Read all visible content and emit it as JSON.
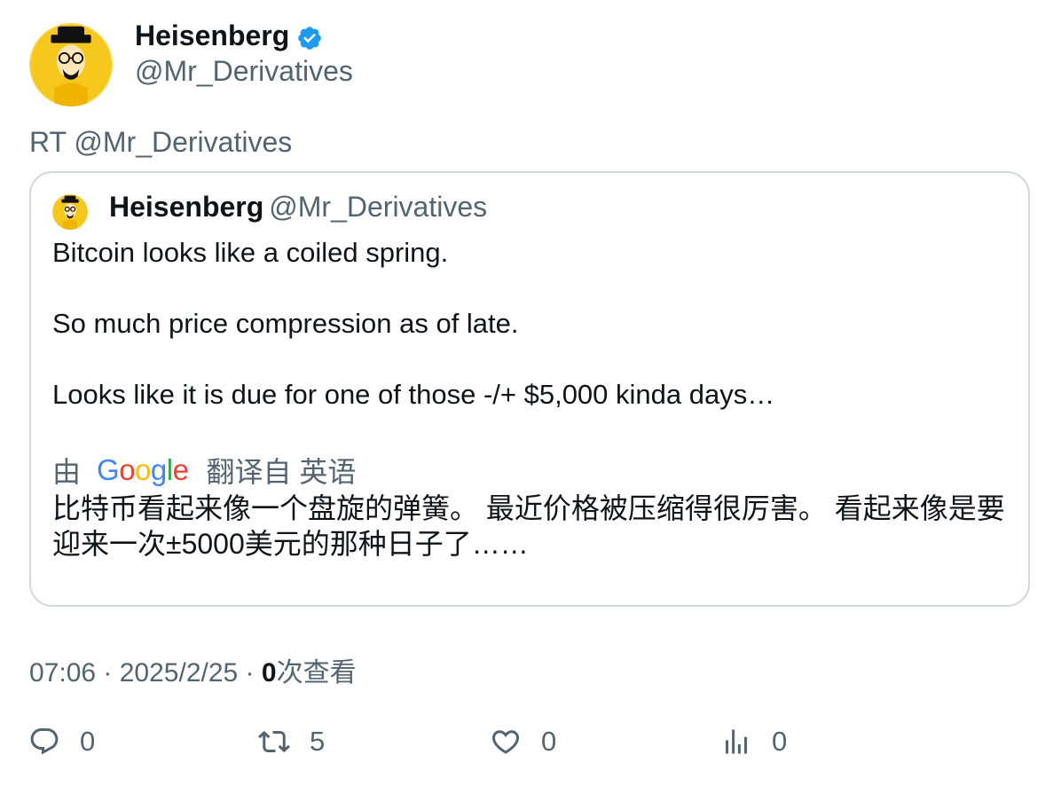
{
  "author": {
    "display_name": "Heisenberg",
    "handle": "@Mr_Derivatives",
    "avatar_icon": "heisenberg-avatar-icon",
    "verified_icon": "verified-badge-icon"
  },
  "retweet_line": "RT @Mr_Derivatives",
  "quoted": {
    "display_name": "Heisenberg",
    "handle": "@Mr_Derivatives",
    "lines": [
      "Bitcoin looks like a coiled spring.",
      "So much price compression as of late.",
      "Looks like it is due for one of those -/+ $5,000 kinda days…"
    ],
    "translate_by": "由",
    "translate_provider": "Google",
    "translate_from": "翻译自 英语",
    "translation": "比特币看起来像一个盘旋的弹簧。 最近价格被压缩得很厉害。 看起来像是要迎来一次±5000美元的那种日子了……"
  },
  "meta": {
    "time": "07:06",
    "separator1": " · ",
    "date": "2025/2/25",
    "separator2": " · ",
    "views_count": "0",
    "views_label": "次查看"
  },
  "actions": {
    "reply_count": "0",
    "retweet_count": "5",
    "like_count": "0",
    "views_count": "0"
  },
  "colors": {
    "text_primary": "#0f1419",
    "text_secondary": "#536471",
    "border": "#cfd9de",
    "verified_blue": "#1d9bf0"
  }
}
